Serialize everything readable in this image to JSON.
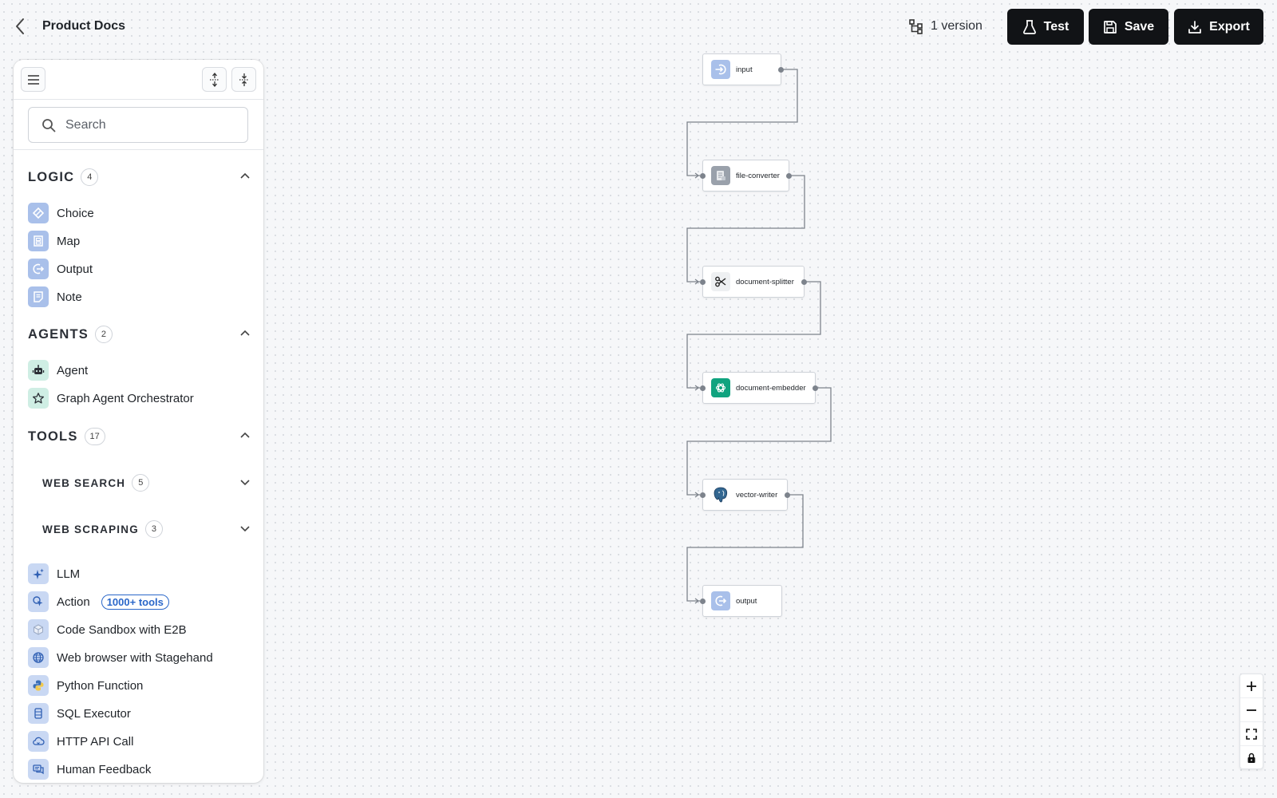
{
  "header": {
    "title": "Product Docs",
    "version_label": "1 version",
    "test_label": "Test",
    "save_label": "Save",
    "export_label": "Export"
  },
  "sidebar": {
    "search_placeholder": "Search",
    "sections": {
      "logic": {
        "title": "LOGIC",
        "count": "4",
        "items": [
          "Choice",
          "Map",
          "Output",
          "Note"
        ]
      },
      "agents": {
        "title": "AGENTS",
        "count": "2",
        "items": [
          "Agent",
          "Graph Agent Orchestrator"
        ]
      },
      "tools": {
        "title": "TOOLS",
        "count": "17",
        "subsections": [
          {
            "title": "WEB SEARCH",
            "count": "5"
          },
          {
            "title": "WEB SCRAPING",
            "count": "3"
          }
        ],
        "items": [
          "LLM",
          "Action",
          "Code Sandbox with E2B",
          "Web browser with Stagehand",
          "Python Function",
          "SQL Executor",
          "HTTP API Call",
          "Human Feedback"
        ],
        "action_badge": "1000+ tools"
      }
    }
  },
  "canvas": {
    "nodes": [
      "input",
      "file-converter",
      "document-splitter",
      "document-embedder",
      "vector-writer",
      "output"
    ]
  },
  "colors": {
    "button_bg": "#111316",
    "accent_blue": "#2a67c9",
    "icon_blue": "#a9c0ea",
    "icon_green": "#cfeee4",
    "openai_green": "#10a37f",
    "postgres_blue": "#336791"
  }
}
